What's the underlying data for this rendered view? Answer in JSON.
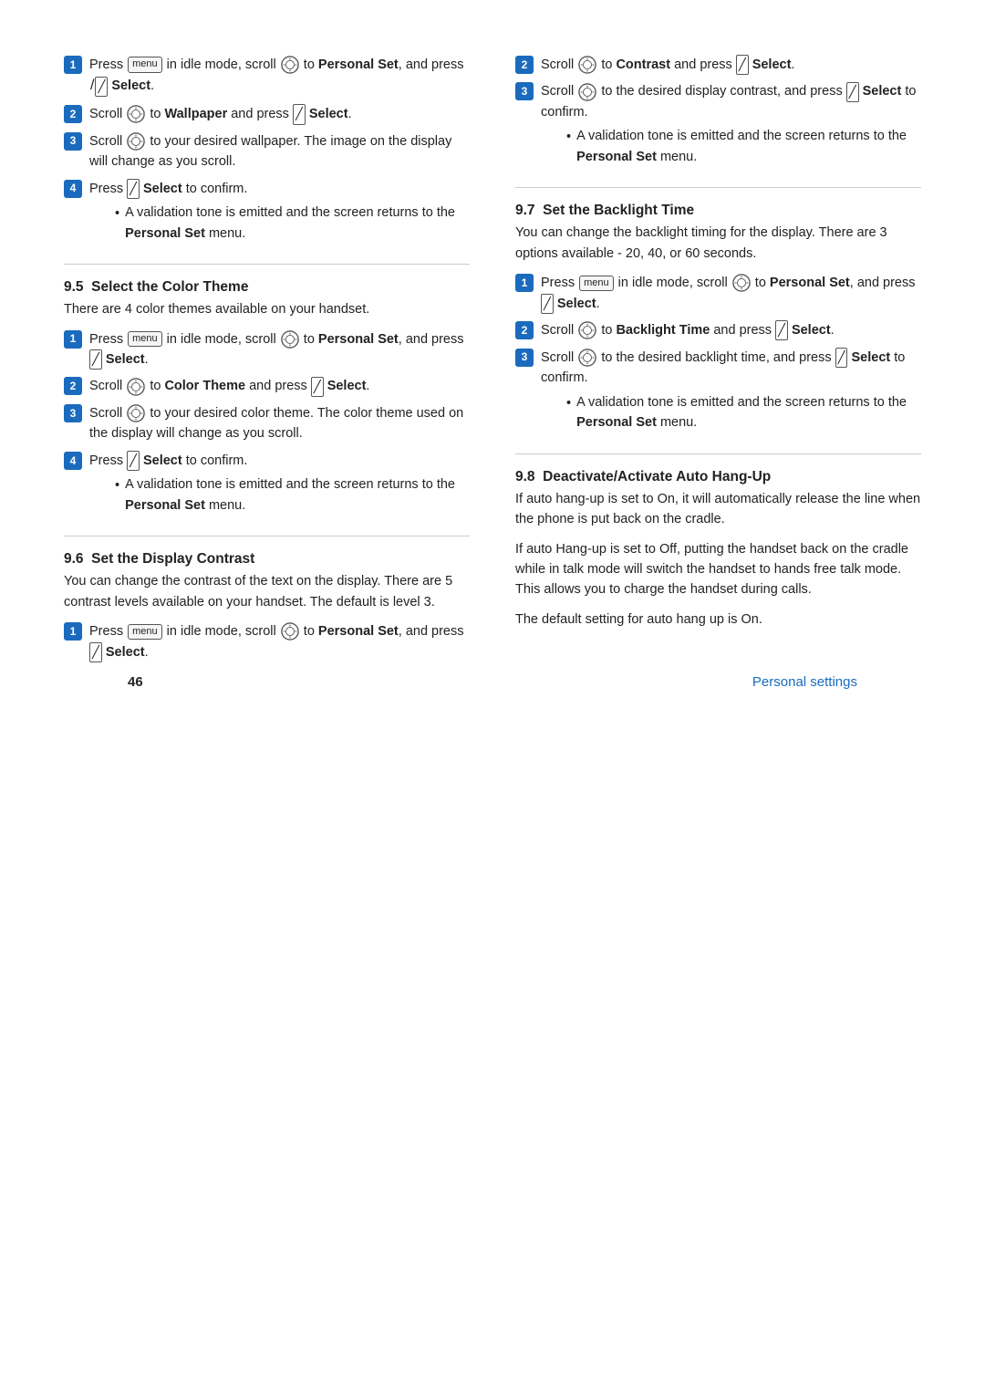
{
  "page": {
    "number": "46",
    "label": "Personal settings"
  },
  "left_col": {
    "step_blocks": [
      {
        "id": "block-wallpaper",
        "steps": [
          {
            "num": "1",
            "html": "Press <menu> in idle mode, scroll <scroll> to <b>Personal Set</b>, and press <select> <b>Select</b>."
          },
          {
            "num": "2",
            "html": "Scroll <scroll> to <b>Wallpaper</b> and press <select> <b>Select</b>."
          },
          {
            "num": "3",
            "html": "Scroll <scroll> to your desired wallpaper. The image on the display will change as you scroll."
          },
          {
            "num": "4",
            "html": "Press <select> <b>Select</b> to confirm.",
            "bullet": "A validation tone is emitted and the screen returns to the <b>Personal Set</b> menu."
          }
        ]
      }
    ],
    "section_95": {
      "number": "9.5",
      "title": "Select the Color Theme",
      "desc": "There are 4 color themes available on your handset.",
      "steps": [
        {
          "num": "1",
          "html": "Press <menu> in idle mode, scroll <scroll> to <b>Personal Set</b>, and press <select> <b>Select</b>."
        },
        {
          "num": "2",
          "html": "Scroll <scroll> to <b>Color Theme</b> and press <select> <b>Select</b>."
        },
        {
          "num": "3",
          "html": "Scroll <scroll> to your desired color theme. The color theme used on the display will change as you scroll."
        },
        {
          "num": "4",
          "html": "Press <select> <b>Select</b> to confirm.",
          "bullet": "A validation tone is emitted and the screen returns to the <b>Personal Set</b> menu."
        }
      ]
    },
    "section_96": {
      "number": "9.6",
      "title": "Set the Display Contrast",
      "desc": "You can change the contrast of the text on the display. There are 5 contrast levels available on your handset. The default is level 3.",
      "steps": [
        {
          "num": "1",
          "html": "Press <menu> in idle mode, scroll <scroll> to <b>Personal Set</b>, and press <select> <b>Select</b>."
        }
      ]
    }
  },
  "right_col": {
    "section_96_continued": {
      "steps": [
        {
          "num": "2",
          "html": "Scroll <scroll> to <b>Contrast</b> and press <select> <b>Select</b>."
        },
        {
          "num": "3",
          "html": "Scroll <scroll> to the desired display contrast, and press <select> <b>Select</b> to confirm.",
          "bullet": "A validation tone is emitted and the screen returns to the <b>Personal Set</b> menu."
        }
      ]
    },
    "section_97": {
      "number": "9.7",
      "title": "Set the Backlight Time",
      "desc": "You can change the backlight timing for the display. There are 3 options available - 20, 40, or 60 seconds.",
      "steps": [
        {
          "num": "1",
          "html": "Press <menu> in idle mode, scroll <scroll> to <b>Personal Set</b>, and press <select> <b>Select</b>."
        },
        {
          "num": "2",
          "html": "Scroll <scroll> to <b>Backlight Time</b> and press <select> <b>Select</b>."
        },
        {
          "num": "3",
          "html": "Scroll <scroll> to the desired backlight time, and press <select> <b>Select</b> to confirm.",
          "bullet": "A validation tone is emitted and the screen returns to the <b>Personal Set</b> menu."
        }
      ]
    },
    "section_98": {
      "number": "9.8",
      "title": "Deactivate/Activate Auto Hang-Up",
      "desc1": "If auto hang-up is set to On, it will automatically release the line when the phone is put back on the cradle.",
      "desc2": "If auto Hang-up is set to Off, putting the handset back on the cradle while in talk mode will switch the handset to hands free talk mode. This allows you to charge the handset during calls.",
      "desc3": "The default setting for auto hang up is On."
    }
  }
}
